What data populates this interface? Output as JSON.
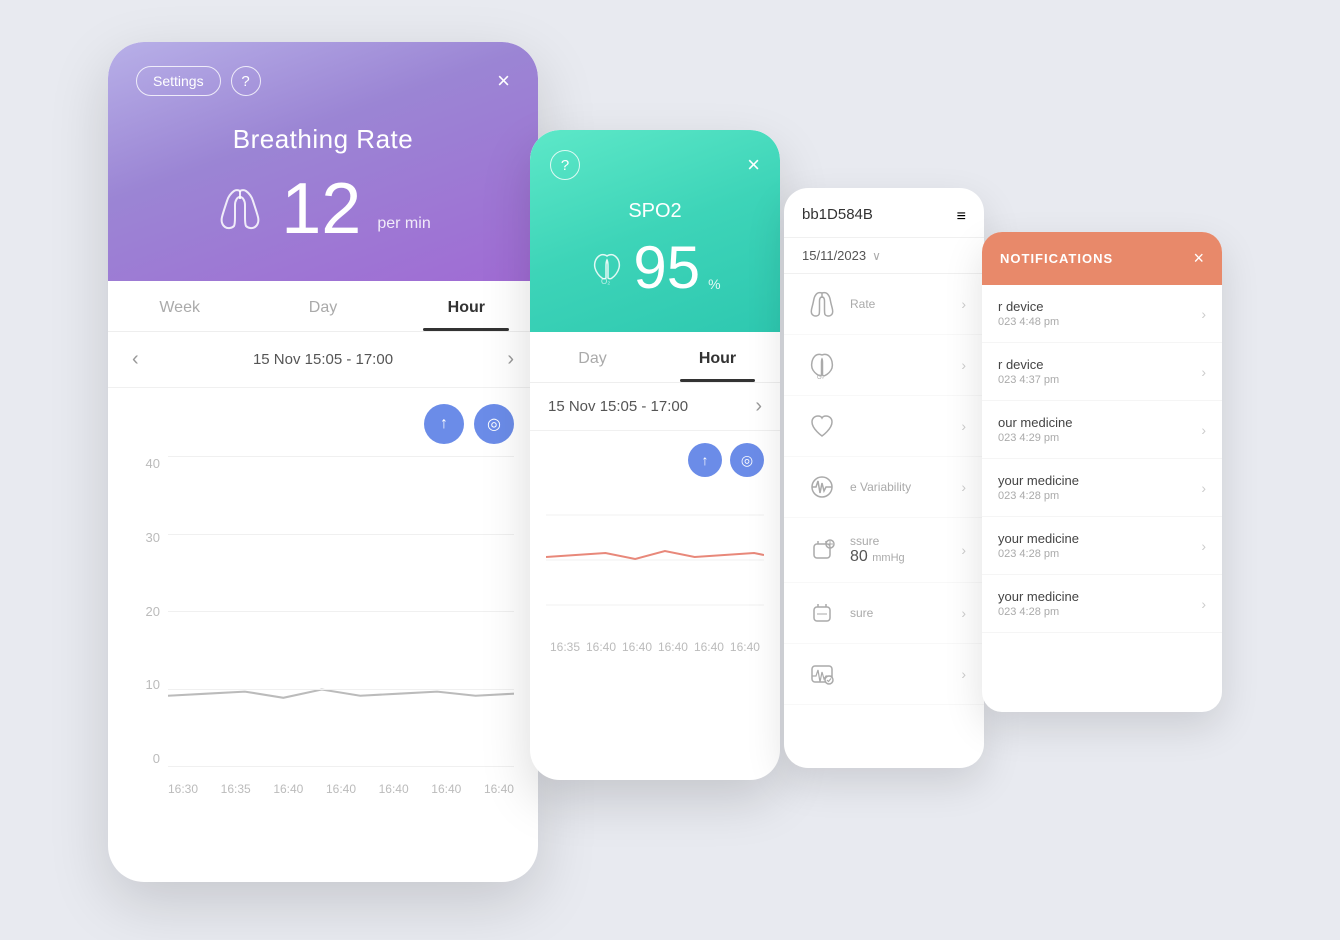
{
  "card1": {
    "settings_label": "Settings",
    "help_label": "?",
    "close_label": "×",
    "title": "Breathing Rate",
    "metric_value": "12",
    "metric_unit": "per min",
    "tabs": [
      "Week",
      "Day",
      "Hour"
    ],
    "active_tab": "Hour",
    "nav_date": "15 Nov 15:05 - 17:00",
    "y_labels": [
      "40",
      "30",
      "20",
      "10",
      "0"
    ],
    "x_labels": [
      "16:30",
      "16:35",
      "16:40",
      "16:40",
      "16:40",
      "16:40",
      "16:40"
    ],
    "share_icon": "↑",
    "pin_icon": "📍"
  },
  "card2": {
    "help_label": "?",
    "close_label": "×",
    "title": "SPO2",
    "metric_value": "95",
    "metric_unit": "%",
    "tabs": [
      "Day",
      "Hour"
    ],
    "active_tab": "Hour",
    "nav_date": "15 Nov 15:05 - 17:00",
    "x_labels": [
      "16:35",
      "16:40",
      "16:40",
      "16:40",
      "16:40",
      "16:40"
    ]
  },
  "card3": {
    "device_id": "bb1D584B",
    "date": "15/11/2023",
    "metrics": [
      {
        "name": "breathing-icon",
        "label": "Rate",
        "value": ""
      },
      {
        "name": "spo2-icon",
        "label": "",
        "value": ""
      },
      {
        "name": "heart-icon",
        "label": "",
        "value": ""
      },
      {
        "name": "hrv-icon",
        "label": "e Variability",
        "value": ""
      },
      {
        "name": "bp-icon",
        "label": "ssure",
        "value": "80 mmHg"
      },
      {
        "name": "bp2-icon",
        "label": "sure",
        "value": ""
      },
      {
        "name": "ecg-icon",
        "label": "",
        "value": ""
      }
    ]
  },
  "card4": {
    "title": "NOTIFICATIONS",
    "close_label": "×",
    "notifications": [
      {
        "title": "r device",
        "time": "023 4:48 pm"
      },
      {
        "title": "r device",
        "time": "023 4:37 pm"
      },
      {
        "title": "our medicine",
        "time": "023 4:29 pm"
      },
      {
        "title": "your medicine",
        "time": "023 4:28 pm"
      },
      {
        "title": "your medicine",
        "time": "023 4:28 pm"
      },
      {
        "title": "your medicine",
        "time": "023 4:28 pm"
      }
    ]
  }
}
